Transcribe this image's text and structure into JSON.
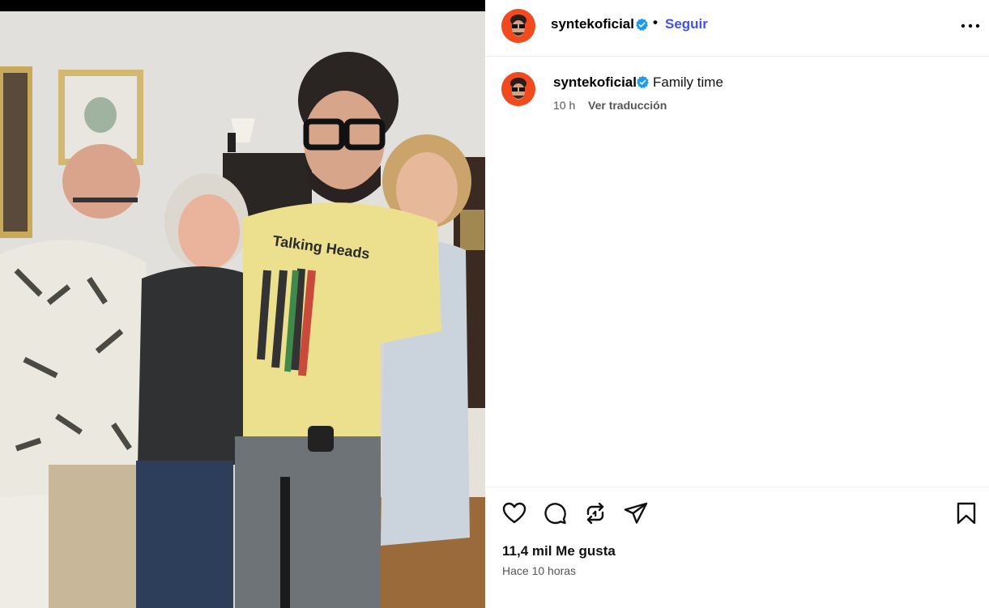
{
  "post": {
    "username": "syntekoficial",
    "separator": "•",
    "follow_label": "Seguir",
    "caption": {
      "username": "syntekoficial",
      "text": "Family time",
      "time": "10 h",
      "translate_label": "Ver traducción"
    },
    "likes": "11,4 mil Me gusta",
    "posted": "Hace 10 horas",
    "photo_shirt_text": "Talking Heads"
  },
  "icons": {
    "header": [
      "verified-badge-icon",
      "more-options-icon"
    ],
    "actions": [
      "heart-icon",
      "comment-icon",
      "repost-icon",
      "share-icon",
      "bookmark-icon"
    ]
  },
  "colors": {
    "follow": "#4150f7",
    "verified": "#1d9bf0",
    "avatar_bg": "#f04a1f"
  }
}
